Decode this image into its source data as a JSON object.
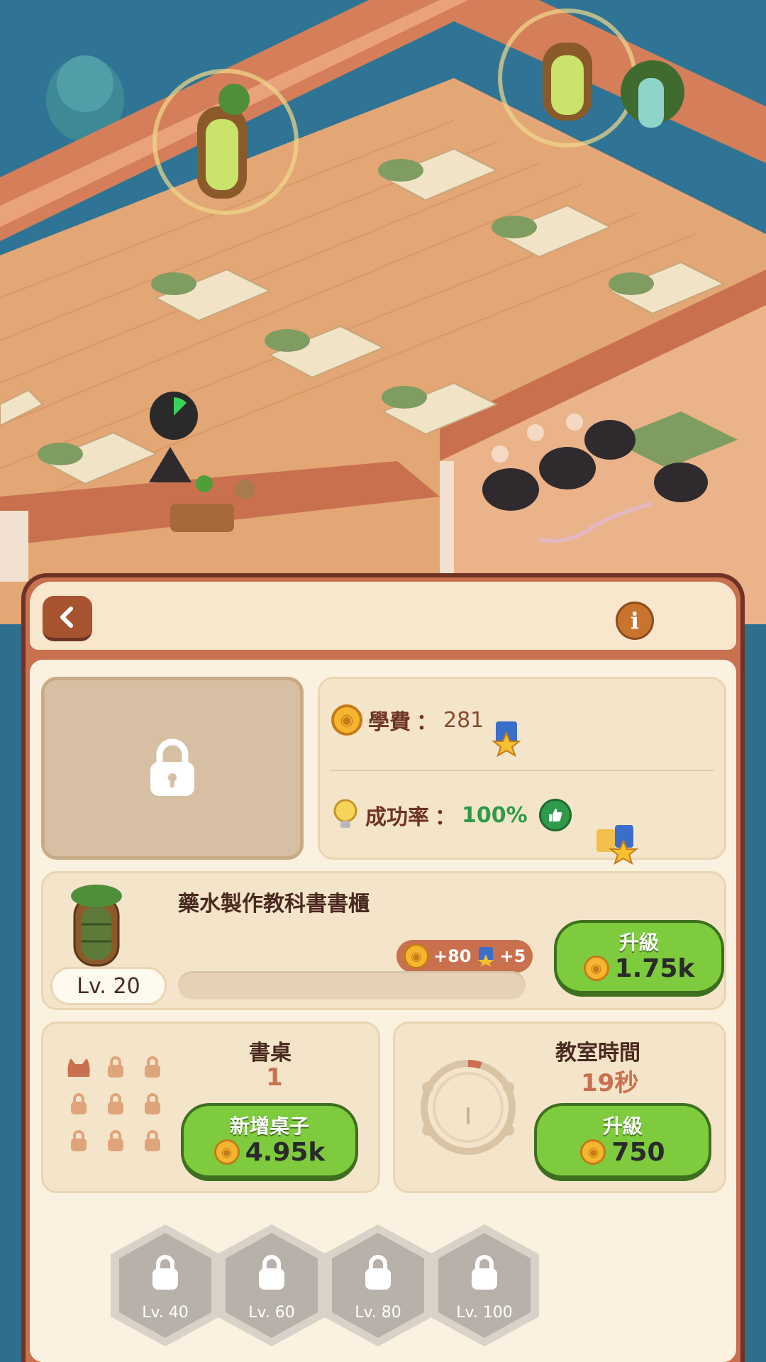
{
  "panel": {
    "title": "",
    "info_label": "i"
  },
  "stats": {
    "tuition_label": "學費",
    "tuition_value": "281",
    "success_label": "成功率",
    "success_value": "100%"
  },
  "upgrade": {
    "item_name": "藥水製作教科書書櫃",
    "level": "Lv. 20",
    "reward_coins": "+80",
    "reward_stars": "+5",
    "button_label": "升級",
    "button_cost": "1.75k"
  },
  "desks": {
    "title": "書桌",
    "count": "1",
    "button_label": "新增桌子",
    "button_cost": "4.95k",
    "slots_unlocked": 1,
    "slots_total": 9
  },
  "classroom_time": {
    "title": "教室時間",
    "value": "19秒",
    "button_label": "升級",
    "button_cost": "750"
  },
  "unlocks": [
    {
      "label": "Lv. 40"
    },
    {
      "label": "Lv. 60"
    },
    {
      "label": "Lv. 80"
    },
    {
      "label": "Lv. 100"
    }
  ],
  "colors": {
    "accent_green": "#7ecb3e",
    "panel_brown": "#c9704f",
    "coin_gold": "#f6b52e",
    "success_green": "#2e9a4a"
  }
}
